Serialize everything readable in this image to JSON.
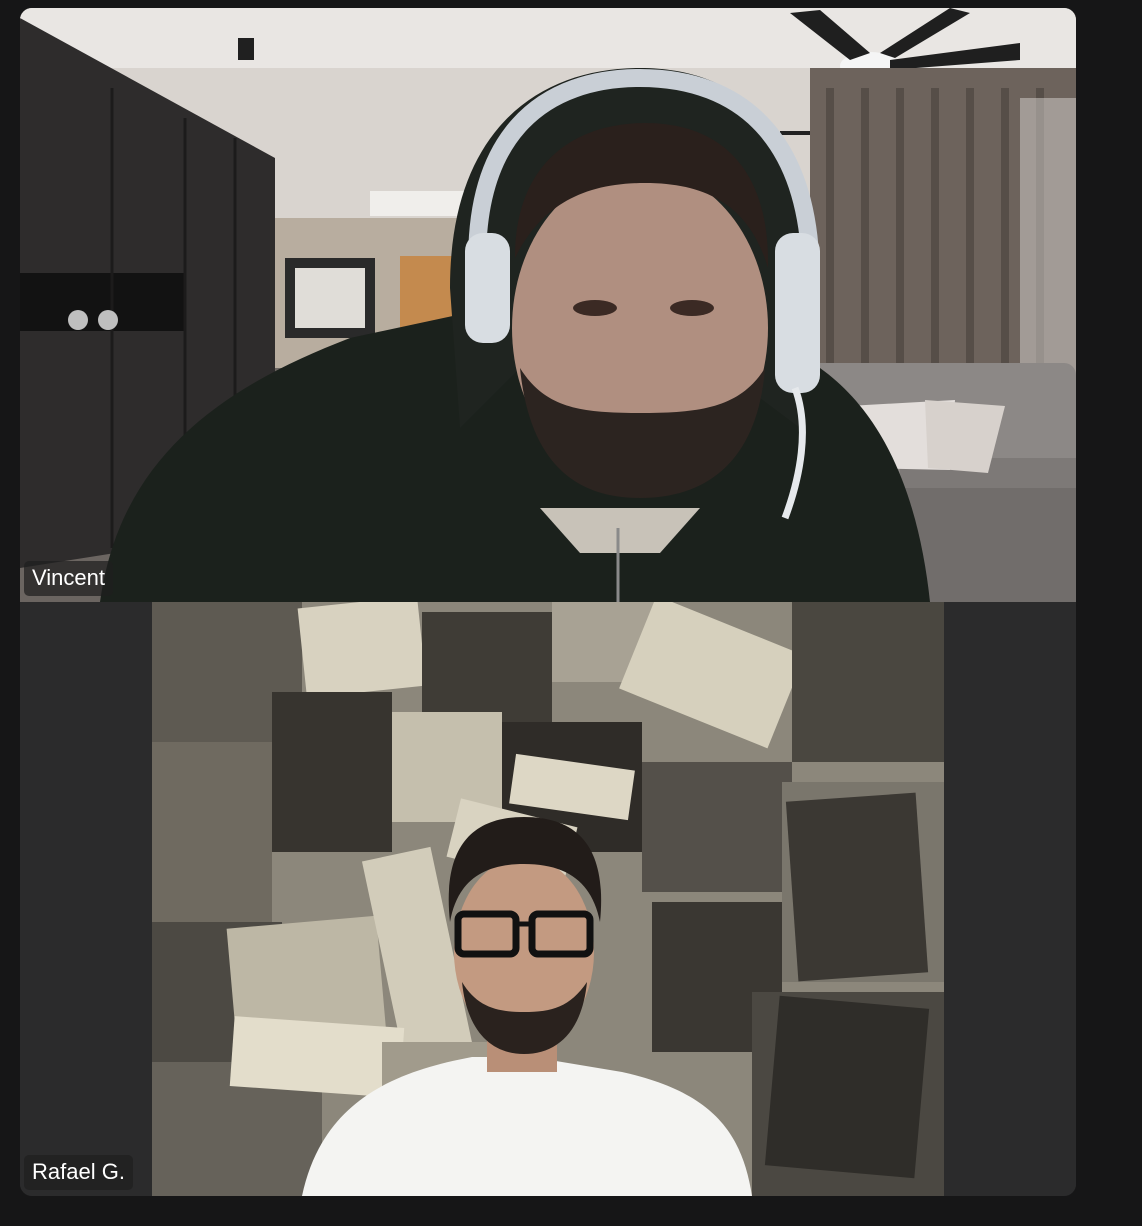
{
  "participants": [
    {
      "name": "Vincent"
    },
    {
      "name": "Rafael G."
    }
  ],
  "icons": {
    "tile_top_video": "participant-video-vincent",
    "tile_bottom_video": "participant-video-rafael"
  },
  "colors": {
    "app_background": "#161617",
    "tile_background": "#2b2b2c",
    "name_tag_background": "#1e1e1e",
    "name_tag_text": "#ffffff"
  }
}
